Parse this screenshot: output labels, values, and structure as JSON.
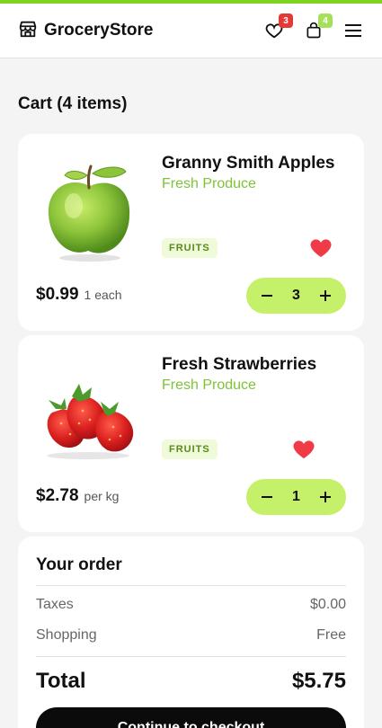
{
  "header": {
    "brand": "GroceryStore",
    "wishlist_count": "3",
    "bag_count": "4",
    "colors": {
      "accent": "#7ed321",
      "badge_red": "#e53935",
      "badge_green": "#a6e05a"
    }
  },
  "cart": {
    "title": "Cart",
    "count_text": "(4 items)"
  },
  "items": [
    {
      "title": "Granny Smith Apples",
      "category": "Fresh Produce",
      "tag": "FRUITS",
      "price": "$0.99",
      "unit": "1 each",
      "quantity": "3",
      "image": "green-apple",
      "favorite": true
    },
    {
      "title": "Fresh Strawberries",
      "category": "Fresh Produce",
      "tag": "FRUITS",
      "price": "$2.78",
      "unit": "per kg",
      "quantity": "1",
      "image": "strawberries",
      "favorite": true
    }
  ],
  "summary": {
    "title": "Your order",
    "taxes_label": "Taxes",
    "taxes_value": "$0.00",
    "shipping_label": "Shopping",
    "shipping_value": "Free",
    "total_label": "Total",
    "total_value": "$5.75",
    "checkout_label": "Continue to checkout"
  }
}
